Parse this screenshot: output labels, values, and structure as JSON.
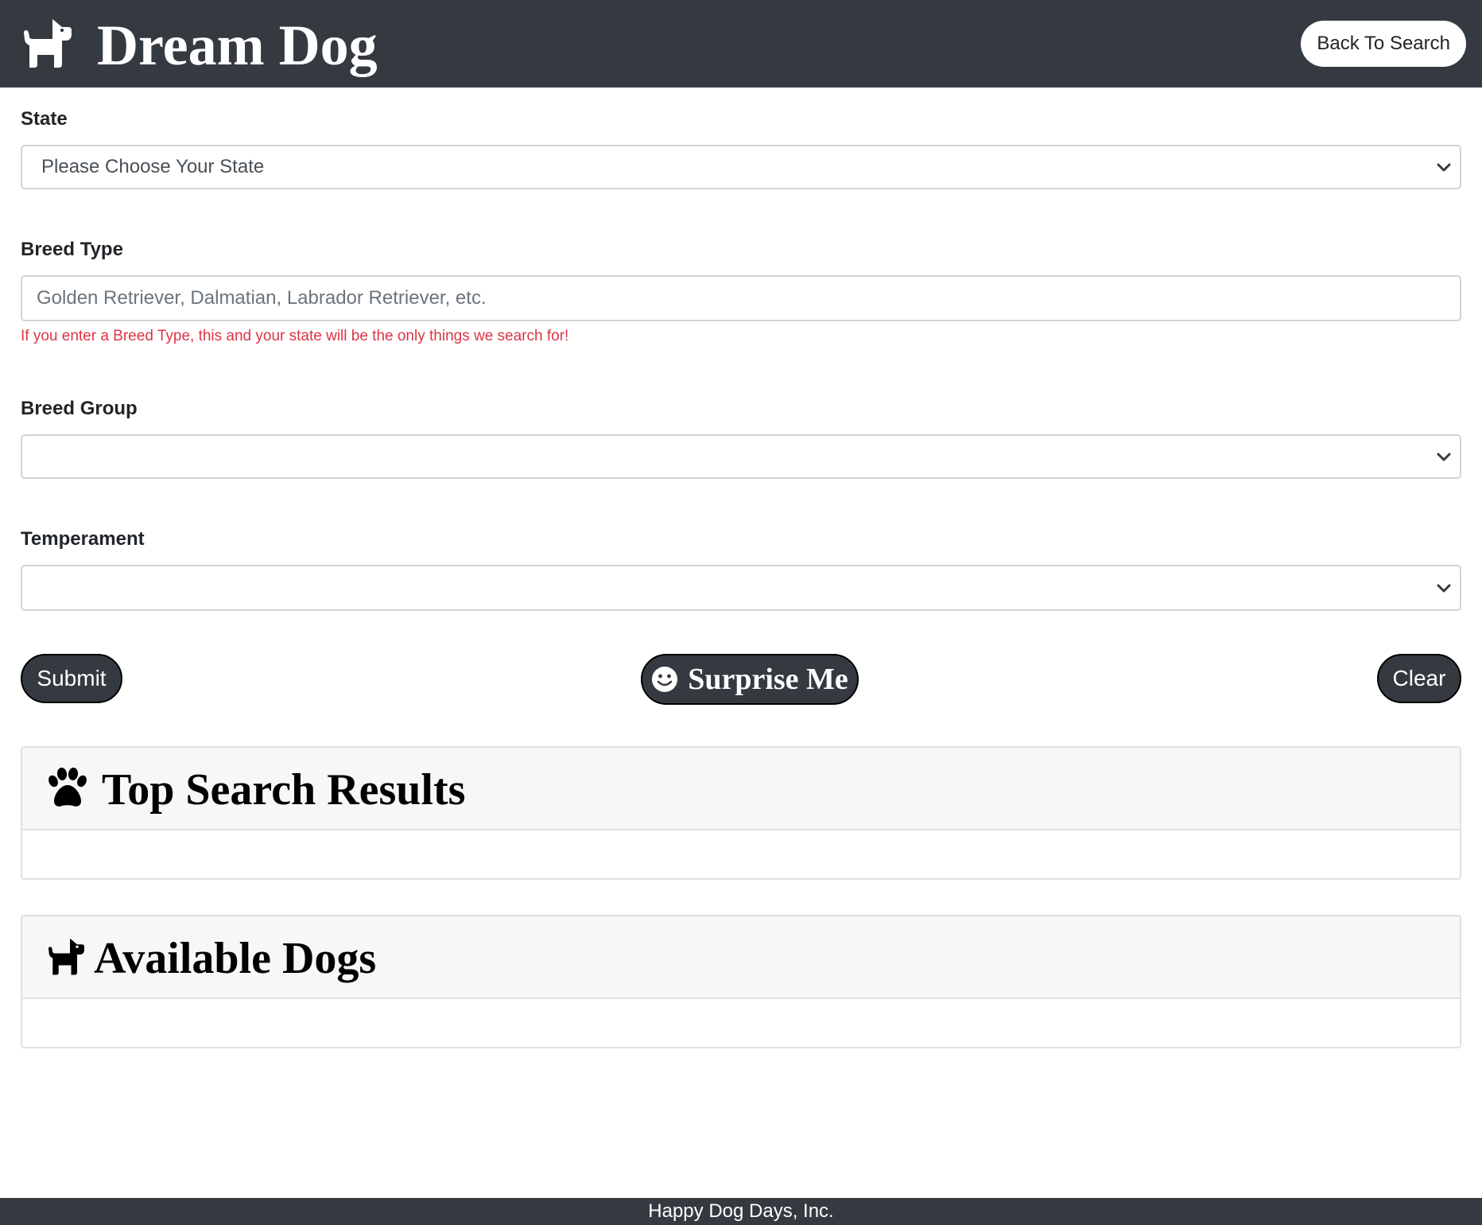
{
  "header": {
    "brand_title": "Dream Dog",
    "brand_icon": "dog-icon",
    "back_button_label": "Back To Search"
  },
  "form": {
    "state": {
      "label": "State",
      "selected": "Please Choose Your State"
    },
    "breed_type": {
      "label": "Breed Type",
      "value": "",
      "placeholder": "Golden Retriever, Dalmatian, Labrador Retriever, etc.",
      "hint": "If you enter a Breed Type, this and your state will be the only things we search for!"
    },
    "breed_group": {
      "label": "Breed Group",
      "selected": ""
    },
    "temperament": {
      "label": "Temperament",
      "selected": ""
    }
  },
  "actions": {
    "submit_label": "Submit",
    "surprise_label": "Surprise Me",
    "surprise_icon": "smile-icon",
    "clear_label": "Clear"
  },
  "cards": {
    "top_results": {
      "title": "Top Search Results",
      "icon": "paw-icon"
    },
    "available_dogs": {
      "title": "Available Dogs",
      "icon": "dog-icon"
    }
  },
  "footer": {
    "text": "Happy Dog Days, Inc."
  },
  "colors": {
    "navbar": "#343a40",
    "hint_text": "#dc3545",
    "card_header": "#f7f7f7",
    "button_dark": "#343a40"
  }
}
